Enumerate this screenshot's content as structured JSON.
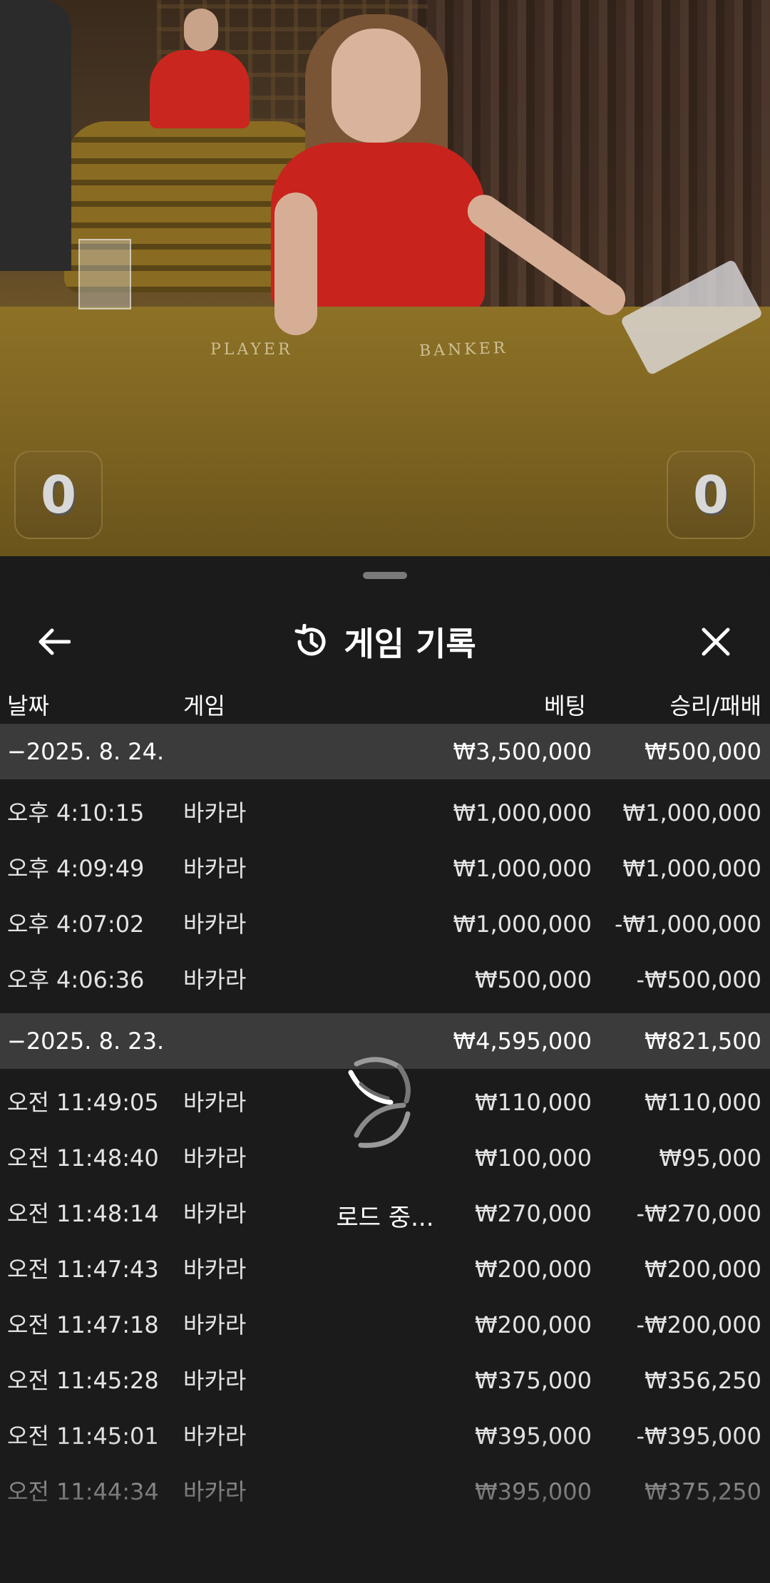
{
  "video": {
    "felt_player": "PLAYER",
    "felt_banker": "BANKER",
    "player_score": "0",
    "banker_score": "0"
  },
  "panel": {
    "title": "게임 기록",
    "columns": {
      "date": "날짜",
      "game": "게임",
      "bet": "베팅",
      "win_loss": "승리/패배"
    },
    "groups": [
      {
        "date": "−2025. 8. 24.",
        "bet": "₩3,500,000",
        "win_loss": "₩500,000",
        "rows": [
          {
            "time": "오후 4:10:15",
            "game": "바카라",
            "bet": "₩1,000,000",
            "win_loss": "₩1,000,000"
          },
          {
            "time": "오후 4:09:49",
            "game": "바카라",
            "bet": "₩1,000,000",
            "win_loss": "₩1,000,000"
          },
          {
            "time": "오후 4:07:02",
            "game": "바카라",
            "bet": "₩1,000,000",
            "win_loss": "-₩1,000,000"
          },
          {
            "time": "오후 4:06:36",
            "game": "바카라",
            "bet": "₩500,000",
            "win_loss": "-₩500,000"
          }
        ]
      },
      {
        "date": "−2025. 8. 23.",
        "bet": "₩4,595,000",
        "win_loss": "₩821,500",
        "rows": [
          {
            "time": "오전 11:49:05",
            "game": "바카라",
            "bet": "₩110,000",
            "win_loss": "₩110,000"
          },
          {
            "time": "오전 11:48:40",
            "game": "바카라",
            "bet": "₩100,000",
            "win_loss": "₩95,000"
          },
          {
            "time": "오전 11:48:14",
            "game": "바카라",
            "bet": "₩270,000",
            "win_loss": "-₩270,000"
          },
          {
            "time": "오전 11:47:43",
            "game": "바카라",
            "bet": "₩200,000",
            "win_loss": "₩200,000"
          },
          {
            "time": "오전 11:47:18",
            "game": "바카라",
            "bet": "₩200,000",
            "win_loss": "-₩200,000"
          },
          {
            "time": "오전 11:45:28",
            "game": "바카라",
            "bet": "₩375,000",
            "win_loss": "₩356,250"
          },
          {
            "time": "오전 11:45:01",
            "game": "바카라",
            "bet": "₩395,000",
            "win_loss": "-₩395,000"
          },
          {
            "time": "오전 11:44:34",
            "game": "바카라",
            "bet": "₩395,000",
            "win_loss": "₩375,250"
          }
        ]
      }
    ],
    "loading_text": "로드 중..."
  },
  "colors": {
    "panel_bg": "#1b1b1b",
    "group_row_bg": "#3b3b3b",
    "text": "#ffffff",
    "felt": "#7a6120"
  },
  "icons": {
    "back": "arrow-left-icon",
    "history": "history-clock-icon",
    "close": "close-x-icon",
    "loading": "loading-spinner-icon"
  }
}
